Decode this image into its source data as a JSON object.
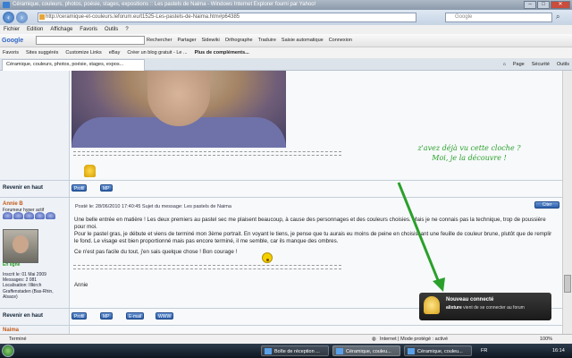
{
  "window": {
    "title": "Céramique, couleurs, photos, poésie, stages, expositions :: Les pastels de Naima - Windows Internet Explorer fourni par Yahoo!",
    "btn_min": "–",
    "btn_max": "□",
    "btn_close": "✕"
  },
  "address": {
    "url": "http://ceramique-et-couleurs.leforum.eu/t1525-Les-pastels-de-Naima.htm#p64385",
    "search_placeholder": "Google"
  },
  "menu": [
    "Fichier",
    "Edition",
    "Affichage",
    "Favoris",
    "Outils",
    "?"
  ],
  "google_toolbar": {
    "logo": "Google",
    "items": [
      "Rechercher",
      "Partager",
      "Sidewiki",
      "Orthographe",
      "Traduire",
      "Saisie automatique",
      "Connexion"
    ]
  },
  "favorites": {
    "label": "Favoris",
    "items": [
      "Sites suggérés",
      "Customize Links",
      "eBay",
      "Créer un blog gratuit - Le ...",
      "Plus de compléments..."
    ]
  },
  "tab": {
    "title": "Céramique, couleurs, photos, poésie, stages, expos..."
  },
  "command_bar": [
    "Page",
    "Sécurité",
    "Outils"
  ],
  "forum": {
    "separator": "____________________________________________________________________",
    "revenir": "Revenir en haut",
    "btn_profil": "Profil",
    "btn_mp": "MP",
    "btn_email": "E-mail",
    "btn_www": "WWW",
    "btn_citer": "Citer",
    "post_header": "Posté le: 28/06/2010 17:40:45    Sujet du message: Les pastels de Naima",
    "author_name": "Annie B",
    "author_rank": "Forumeur hyper actif",
    "online": "En ligne",
    "meta": "Inscrit le: 01 Mai 2009\nMessages: 2 081\nLocalisation: Illkirch\nGraffenstaden (Bas-Rhin,\nAlsace)",
    "post_p1": "Une belle entrée en matière ! Les deux premiers au pastel sec me plaisent beaucoup, à cause des personnages et des couleurs choisies. Mais je ne connais pas la technique, trop de poussière pour moi.",
    "post_p2": "Pour le pastel gras, je débute et viens de terminé mon 3ème portrait. En voyant le tiens, je pense que tu aurais eu moins de peine en choisissant une feuille de couleur brune, plutôt que de remplir le fond. Le visage est bien proportionné mais pas encore terminé, il me semble, car ils manque des ombres.",
    "post_p3": "Ce n'est pas facile du tout, j'en sais quelque chose ! Bon courage !",
    "post_sign": "Annie",
    "next_author": "Naima"
  },
  "annotation": {
    "line1": "z'avez déjà vu cette cloche ?",
    "line2": "Moi, je la découvre !"
  },
  "popup": {
    "title": "Nouveau connecté",
    "user": "alixture",
    "message": " vient de se connecter au forum"
  },
  "status": {
    "left": "Terminé",
    "zone": "Internet | Mode protégé : activé",
    "zoom": "100%"
  },
  "taskbar": {
    "items": [
      "Boîte de réception ...",
      "Céramique, couleu...",
      "Céramique, couleu..."
    ],
    "lang": "FR",
    "clock": "16:14"
  },
  "colors": {
    "annotation": "#2aa02a",
    "author": "#c25a18"
  }
}
